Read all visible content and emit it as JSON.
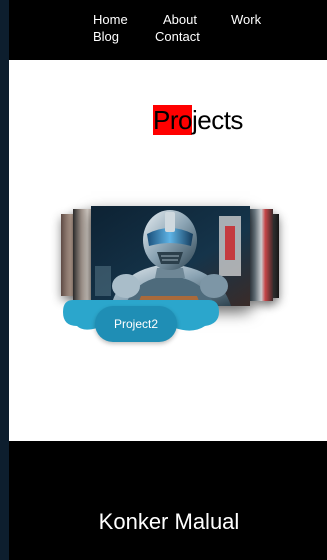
{
  "nav": {
    "items": [
      "Home",
      "About",
      "Work",
      "Blog",
      "Contact"
    ]
  },
  "projects": {
    "title_highlight": "Pro",
    "title_rest": "jects",
    "active_slide_caption": "Project2"
  },
  "footer": {
    "name": "Konker Malual"
  },
  "colors": {
    "header_bg": "#000000",
    "content_bg": "#ffffff",
    "title_highlight": "#ff0000",
    "caption_bubble": "#1f8eb5",
    "outer_bg": "#0d1e2e"
  }
}
